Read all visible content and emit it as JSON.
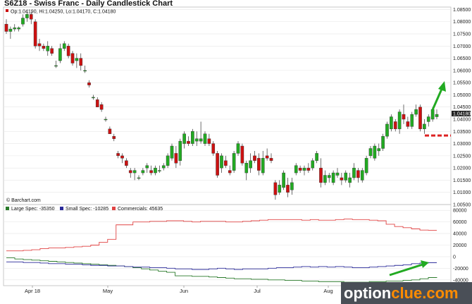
{
  "chart_data": [
    {
      "type": "candlestick",
      "title": "S6Z18 - Swiss Franc - Daily Candlestick Chart",
      "ohlc_label": "Op:1.04190, Hi:1.04250, Lo:1.04170, C:1.04180",
      "last_price_label": "1.04180",
      "source_label": "© Barchart.com",
      "y_ticks": [
        "1.08500",
        "1.08000",
        "1.07500",
        "1.07000",
        "1.06500",
        "1.06000",
        "1.05500",
        "1.05000",
        "1.04500",
        "1.04000",
        "1.03500",
        "1.03000",
        "1.02500",
        "1.02000",
        "1.01500",
        "1.01000",
        "1.00500"
      ],
      "ylim": [
        1.005,
        1.086
      ],
      "colors": {
        "up": "#22aa22",
        "down": "#cc1111",
        "arrow": "#22aa22",
        "support": "#dd2222"
      },
      "resistance_level": 1.0333,
      "candles": [
        [
          1.079,
          1.081,
          1.075,
          1.076
        ],
        [
          1.076,
          1.078,
          1.073,
          1.077
        ],
        [
          1.077,
          1.079,
          1.076,
          1.0775
        ],
        [
          1.077,
          1.078,
          1.076,
          1.0775
        ],
        [
          1.079,
          1.083,
          1.078,
          1.0815
        ],
        [
          1.0815,
          1.084,
          1.08,
          1.083
        ],
        [
          1.083,
          1.084,
          1.079,
          1.081
        ],
        [
          1.08,
          1.081,
          1.069,
          1.07
        ],
        [
          1.071,
          1.073,
          1.068,
          1.07
        ],
        [
          1.07,
          1.071,
          1.068,
          1.069
        ],
        [
          1.068,
          1.072,
          1.066,
          1.07
        ],
        [
          1.069,
          1.07,
          1.066,
          1.067
        ],
        [
          1.062,
          1.064,
          1.061,
          1.062
        ],
        [
          1.064,
          1.071,
          1.063,
          1.069
        ],
        [
          1.069,
          1.072,
          1.068,
          1.071
        ],
        [
          1.07,
          1.071,
          1.065,
          1.066
        ],
        [
          1.067,
          1.068,
          1.062,
          1.063
        ],
        [
          1.064,
          1.067,
          1.061,
          1.065
        ],
        [
          1.065,
          1.067,
          1.06,
          1.062
        ],
        [
          1.06,
          1.062,
          1.059,
          1.06
        ],
        [
          1.055,
          1.056,
          1.053,
          1.054
        ],
        [
          1.049,
          1.05,
          1.048,
          1.049
        ],
        [
          1.048,
          1.049,
          1.045,
          1.045
        ],
        [
          1.046,
          1.047,
          1.043,
          1.044
        ],
        [
          1.04,
          1.041,
          1.039,
          1.04
        ],
        [
          1.036,
          1.037,
          1.034,
          1.034
        ],
        [
          1.033,
          1.034,
          1.031,
          1.032
        ],
        [
          1.026,
          1.027,
          1.024,
          1.025
        ],
        [
          1.025,
          1.026,
          1.022,
          1.024
        ],
        [
          1.023,
          1.024,
          1.02,
          1.021
        ],
        [
          1.019,
          1.02,
          1.016,
          1.018
        ],
        [
          1.018,
          1.02,
          1.015,
          1.019
        ],
        [
          1.016,
          1.017,
          1.015,
          1.016
        ],
        [
          1.018,
          1.02,
          1.017,
          1.019
        ],
        [
          1.02,
          1.022,
          1.018,
          1.021
        ],
        [
          1.019,
          1.021,
          1.017,
          1.018
        ],
        [
          1.018,
          1.021,
          1.017,
          1.02
        ],
        [
          1.019,
          1.021,
          1.018,
          1.019
        ],
        [
          1.02,
          1.022,
          1.019,
          1.021
        ],
        [
          1.021,
          1.026,
          1.02,
          1.025
        ],
        [
          1.024,
          1.03,
          1.023,
          1.029
        ],
        [
          1.026,
          1.029,
          1.02,
          1.022
        ],
        [
          1.023,
          1.032,
          1.021,
          1.031
        ],
        [
          1.03,
          1.035,
          1.028,
          1.034
        ],
        [
          1.031,
          1.033,
          1.029,
          1.03
        ],
        [
          1.03,
          1.036,
          1.029,
          1.035
        ],
        [
          1.031,
          1.035,
          1.029,
          1.032
        ],
        [
          1.031,
          1.039,
          1.03,
          1.032
        ],
        [
          1.03,
          1.035,
          1.029,
          1.034
        ],
        [
          1.032,
          1.034,
          1.029,
          1.03
        ],
        [
          1.03,
          1.031,
          1.025,
          1.026
        ],
        [
          1.026,
          1.027,
          1.016,
          1.017
        ],
        [
          1.02,
          1.026,
          1.018,
          1.025
        ],
        [
          1.023,
          1.025,
          1.02,
          1.021
        ],
        [
          1.019,
          1.021,
          1.017,
          1.018
        ],
        [
          1.019,
          1.027,
          1.018,
          1.026
        ],
        [
          1.026,
          1.031,
          1.025,
          1.03
        ],
        [
          1.029,
          1.03,
          1.021,
          1.022
        ],
        [
          1.018,
          1.023,
          1.015,
          1.022
        ],
        [
          1.02,
          1.026,
          1.018,
          1.023
        ],
        [
          1.025,
          1.027,
          1.022,
          1.023
        ],
        [
          1.024,
          1.026,
          1.017,
          1.019
        ],
        [
          1.018,
          1.027,
          1.017,
          1.024
        ],
        [
          1.025,
          1.028,
          1.023,
          1.024
        ],
        [
          1.024,
          1.026,
          1.022,
          1.023
        ],
        [
          1.014,
          1.015,
          1.007,
          1.009
        ],
        [
          1.01,
          1.015,
          1.009,
          1.013
        ],
        [
          1.012,
          1.019,
          1.011,
          1.018
        ],
        [
          1.013,
          1.016,
          1.008,
          1.01
        ],
        [
          1.011,
          1.016,
          1.009,
          1.014
        ],
        [
          1.018,
          1.022,
          1.017,
          1.021
        ],
        [
          1.02,
          1.021,
          1.018,
          1.019
        ],
        [
          1.019,
          1.021,
          1.017,
          1.02
        ],
        [
          1.02,
          1.022,
          1.018,
          1.019
        ],
        [
          1.02,
          1.024,
          1.019,
          1.023
        ],
        [
          1.023,
          1.027,
          1.022,
          1.026
        ],
        [
          1.02,
          1.024,
          1.012,
          1.014
        ],
        [
          1.014,
          1.019,
          1.013,
          1.017
        ],
        [
          1.016,
          1.018,
          1.014,
          1.017
        ],
        [
          1.014,
          1.019,
          1.013,
          1.018
        ],
        [
          1.017,
          1.02,
          1.016,
          1.018
        ],
        [
          1.016,
          1.018,
          1.013,
          1.015
        ],
        [
          1.015,
          1.019,
          1.014,
          1.018
        ],
        [
          1.014,
          1.018,
          1.012,
          1.016
        ],
        [
          1.016,
          1.022,
          1.015,
          1.02
        ],
        [
          1.019,
          1.02,
          1.014,
          1.016
        ],
        [
          1.015,
          1.02,
          1.014,
          1.019
        ],
        [
          1.018,
          1.025,
          1.017,
          1.024
        ],
        [
          1.025,
          1.029,
          1.024,
          1.028
        ],
        [
          1.024,
          1.03,
          1.023,
          1.029
        ],
        [
          1.027,
          1.03,
          1.025,
          1.028
        ],
        [
          1.028,
          1.034,
          1.027,
          1.033
        ],
        [
          1.033,
          1.039,
          1.032,
          1.038
        ],
        [
          1.036,
          1.042,
          1.035,
          1.041
        ],
        [
          1.039,
          1.04,
          1.035,
          1.036
        ],
        [
          1.036,
          1.044,
          1.034,
          1.043
        ],
        [
          1.042,
          1.046,
          1.038,
          1.04
        ],
        [
          1.039,
          1.041,
          1.036,
          1.037
        ],
        [
          1.037,
          1.043,
          1.036,
          1.042
        ],
        [
          1.042,
          1.046,
          1.041,
          1.044
        ],
        [
          1.045,
          1.046,
          1.035,
          1.036
        ],
        [
          1.036,
          1.04,
          1.034,
          1.038
        ],
        [
          1.039,
          1.042,
          1.037,
          1.041
        ],
        [
          1.04,
          1.045,
          1.039,
          1.044
        ],
        [
          1.041,
          1.044,
          1.04,
          1.042
        ]
      ]
    },
    {
      "type": "line",
      "title": "",
      "x_tick_labels": [
        "Apr 18",
        "May",
        "Jun",
        "Jul",
        "Aug"
      ],
      "y_ticks": [
        "80000",
        "60000",
        "40000",
        "20000",
        "0",
        "-20000",
        "-40000"
      ],
      "ylim": [
        -50000,
        90000
      ],
      "series": [
        {
          "name": "Large Spec: -35350",
          "color": "#2a7a2a",
          "values": [
            -2000,
            -4000,
            -5000,
            -6000,
            -7000,
            -8000,
            -9000,
            -10000,
            -11000,
            -12000,
            -13000,
            -14000,
            -15000,
            -16000,
            -17000,
            -19000,
            -21000,
            -23000,
            -25000,
            -27000,
            -33000,
            -33000,
            -34000,
            -34000,
            -35000,
            -36000,
            -37000,
            -38000,
            -38000,
            -39000,
            -39000,
            -40000,
            -40000,
            -41000,
            -41000,
            -42000,
            -42000,
            -43000,
            -43000,
            -43000,
            -44000,
            -44000,
            -44000,
            -43000,
            -43000,
            -42000,
            -42000,
            -41000,
            -40000,
            -38000,
            -36000,
            -35350
          ]
        },
        {
          "name": "Small Spec: -10285",
          "color": "#2a2a99",
          "values": [
            -9000,
            -9000,
            -10000,
            -10000,
            -11000,
            -12000,
            -12000,
            -13000,
            -13000,
            -14000,
            -15000,
            -15000,
            -16000,
            -16000,
            -17000,
            -18000,
            -18000,
            -19000,
            -19000,
            -20000,
            -21000,
            -21000,
            -22000,
            -22000,
            -21000,
            -20000,
            -21000,
            -22000,
            -21000,
            -21000,
            -21000,
            -20000,
            -19000,
            -19000,
            -18000,
            -17000,
            -18000,
            -17000,
            -18000,
            -17000,
            -18000,
            -19000,
            -19000,
            -18000,
            -17000,
            -16000,
            -15000,
            -14000,
            -12000,
            -11000,
            -10285,
            -10285
          ]
        },
        {
          "name": "Commercials: 45635",
          "color": "#e04444",
          "values": [
            10000,
            10000,
            11000,
            12000,
            14000,
            15000,
            15000,
            16000,
            17000,
            18000,
            20000,
            25000,
            30000,
            55000,
            55000,
            60000,
            60000,
            61000,
            61000,
            62000,
            62000,
            61000,
            60000,
            61000,
            61000,
            61000,
            60000,
            60000,
            61000,
            62000,
            63000,
            64000,
            64000,
            64000,
            64000,
            63000,
            64000,
            63000,
            63000,
            64000,
            65000,
            64000,
            64000,
            63000,
            62000,
            56000,
            52000,
            50000,
            48000,
            46000,
            45635,
            45635
          ]
        }
      ]
    }
  ],
  "watermark": {
    "part1": "option",
    "part2": "clue.com"
  }
}
